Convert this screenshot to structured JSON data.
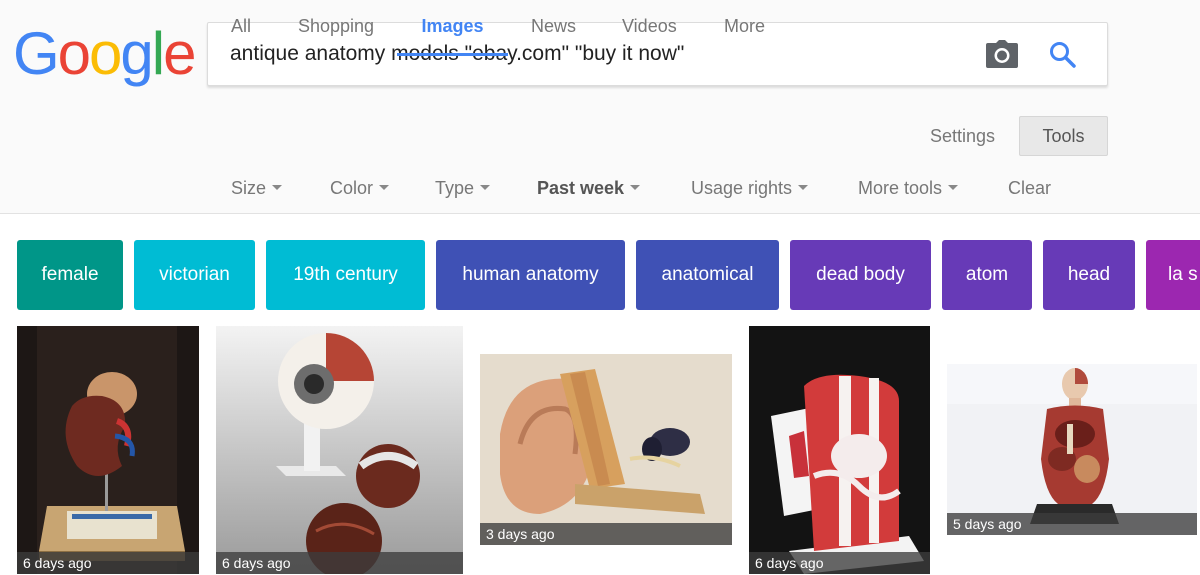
{
  "logo": {
    "letters": [
      "G",
      "o",
      "o",
      "g",
      "l",
      "e"
    ]
  },
  "search": {
    "query": "antique anatomy models \"ebay.com\" \"buy it now\""
  },
  "tabs": [
    {
      "label": "All"
    },
    {
      "label": "Shopping"
    },
    {
      "label": "Images",
      "active": true
    },
    {
      "label": "News"
    },
    {
      "label": "Videos"
    },
    {
      "label": "More"
    }
  ],
  "settings_label": "Settings",
  "tools_label": "Tools",
  "tools": [
    {
      "label": "Size"
    },
    {
      "label": "Color"
    },
    {
      "label": "Type"
    },
    {
      "label": "Past week"
    },
    {
      "label": "Usage rights"
    },
    {
      "label": "More tools"
    },
    {
      "label": "Clear"
    }
  ],
  "chips": [
    {
      "label": "female",
      "color": "#009688"
    },
    {
      "label": "victorian",
      "color": "#00bcd4"
    },
    {
      "label": "19th century",
      "color": "#00bcd4"
    },
    {
      "label": "human anatomy",
      "color": "#3f51b5"
    },
    {
      "label": "anatomical",
      "color": "#3f51b5"
    },
    {
      "label": "dead body",
      "color": "#673ab7"
    },
    {
      "label": "atom",
      "color": "#673ab7"
    },
    {
      "label": "head",
      "color": "#673ab7"
    },
    {
      "label": "la s",
      "color": "#9c27b0"
    }
  ],
  "results": [
    {
      "age": "6 days ago",
      "subject": "kidney-model"
    },
    {
      "age": "6 days ago",
      "subject": "eye-model"
    },
    {
      "age": "3 days ago",
      "subject": "ear-model"
    },
    {
      "age": "6 days ago",
      "subject": "knee-model"
    },
    {
      "age": "5 days ago",
      "subject": "torso-model"
    }
  ],
  "icons": {
    "camera": "camera-icon",
    "search": "search-icon"
  }
}
